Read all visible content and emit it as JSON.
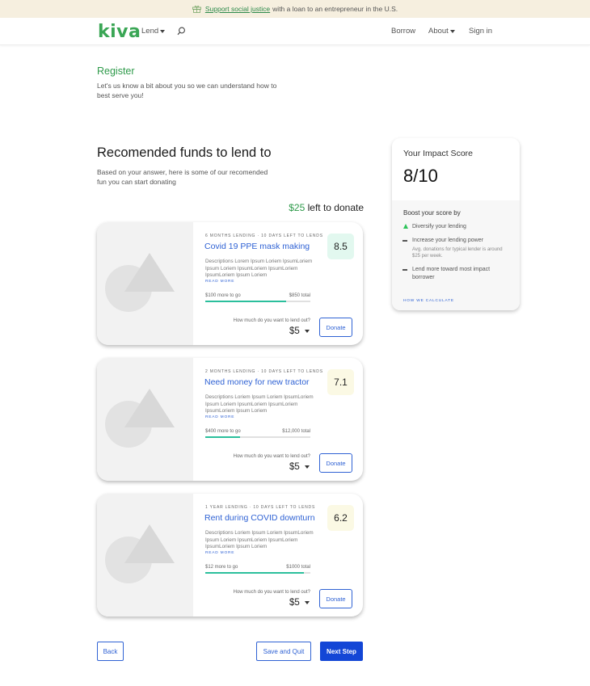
{
  "banner": {
    "link_text": "Support social justice",
    "rest_text": "with a loan to an entrepreneur in the U.S."
  },
  "nav": {
    "logo": "kiva",
    "lend_label": "Lend",
    "borrow_label": "Borrow",
    "about_label": "About",
    "signin_label": "Sign in"
  },
  "register": {
    "title": "Register",
    "subtitle": "Let's us know a bit about you so we can understand how to best serve you!"
  },
  "recommended": {
    "title": "Recomended funds to lend to",
    "subtitle": "Based on your answer, here is some of our recomended fun you can start donating",
    "left_amount": "$25",
    "left_suffix": "left to donate"
  },
  "cards": [
    {
      "meta": "6 MONTHS LENDING · 10 DAYS LEFT TO LENDS",
      "title": "Covid 19 PPE mask making",
      "score": "8.5",
      "score_color": "#e2f8ef",
      "description": "Descriptions Lorem Ipsum Loriem IpsumLoriem Ipsum Loriem IpsumLoriem IpsumLoriem IpsumLoriem Ipsum Loriem",
      "read_more": "READ MORE",
      "to_go": "$100 more to go",
      "total": "$850 total",
      "progress": 0.77,
      "question": "How much do you want to lend out?",
      "amount": "$5",
      "donate": "Donate"
    },
    {
      "meta": "2 MONTHS LENDING · 10 DAYS LEFT TO LENDS",
      "title": "Need money for new tractor",
      "score": "7.1",
      "score_color": "#fbf9e4",
      "description": "Descriptions Loriem Ipsum Loriem IpsumLoriem Ipsum Loriem IpsumLoriem IpsumLoriem IpsumLoriem Ipsum Loriem",
      "read_more": "READ MORE",
      "to_go": "$400 more to go",
      "total": "$12,000 total",
      "progress": 0.33,
      "question": "How much do you want to lend out?",
      "amount": "$5",
      "donate": "Donate"
    },
    {
      "meta": "1 YEAR LENDING · 10 DAYS LEFT TO LENDS",
      "title": "Rent during COVID downturn",
      "score": "6.2",
      "score_color": "#fbf9e4",
      "description": "Descriptions Loriem Ipsum Loriem IpsumLoriem Ipsum Loriem IpsumLoriem IpsumLoriem IpsumLoriem Ipsum Loriem",
      "read_more": "READ MORE",
      "to_go": "$12 more to go",
      "total": "$1000 total",
      "progress": 0.94,
      "question": "How much do you want to lend out?",
      "amount": "$5",
      "donate": "Donate"
    }
  ],
  "impact": {
    "title": "Your Impact Score",
    "value": "8/10",
    "boost_title": "Boost your score by",
    "tips": [
      {
        "text": "Diversify your lending",
        "note": "",
        "marker": "up"
      },
      {
        "text": "Increase your lending power",
        "note": "Avg. donations for typical lender is around $25 per week.",
        "marker": "dash"
      },
      {
        "text": "Lend more toward most impact borrower",
        "note": "",
        "marker": "dash"
      }
    ],
    "how_link": "HOW WE CALCULATE"
  },
  "footer": {
    "back": "Back",
    "save_quit": "Save and Quit",
    "next": "Next Step"
  }
}
